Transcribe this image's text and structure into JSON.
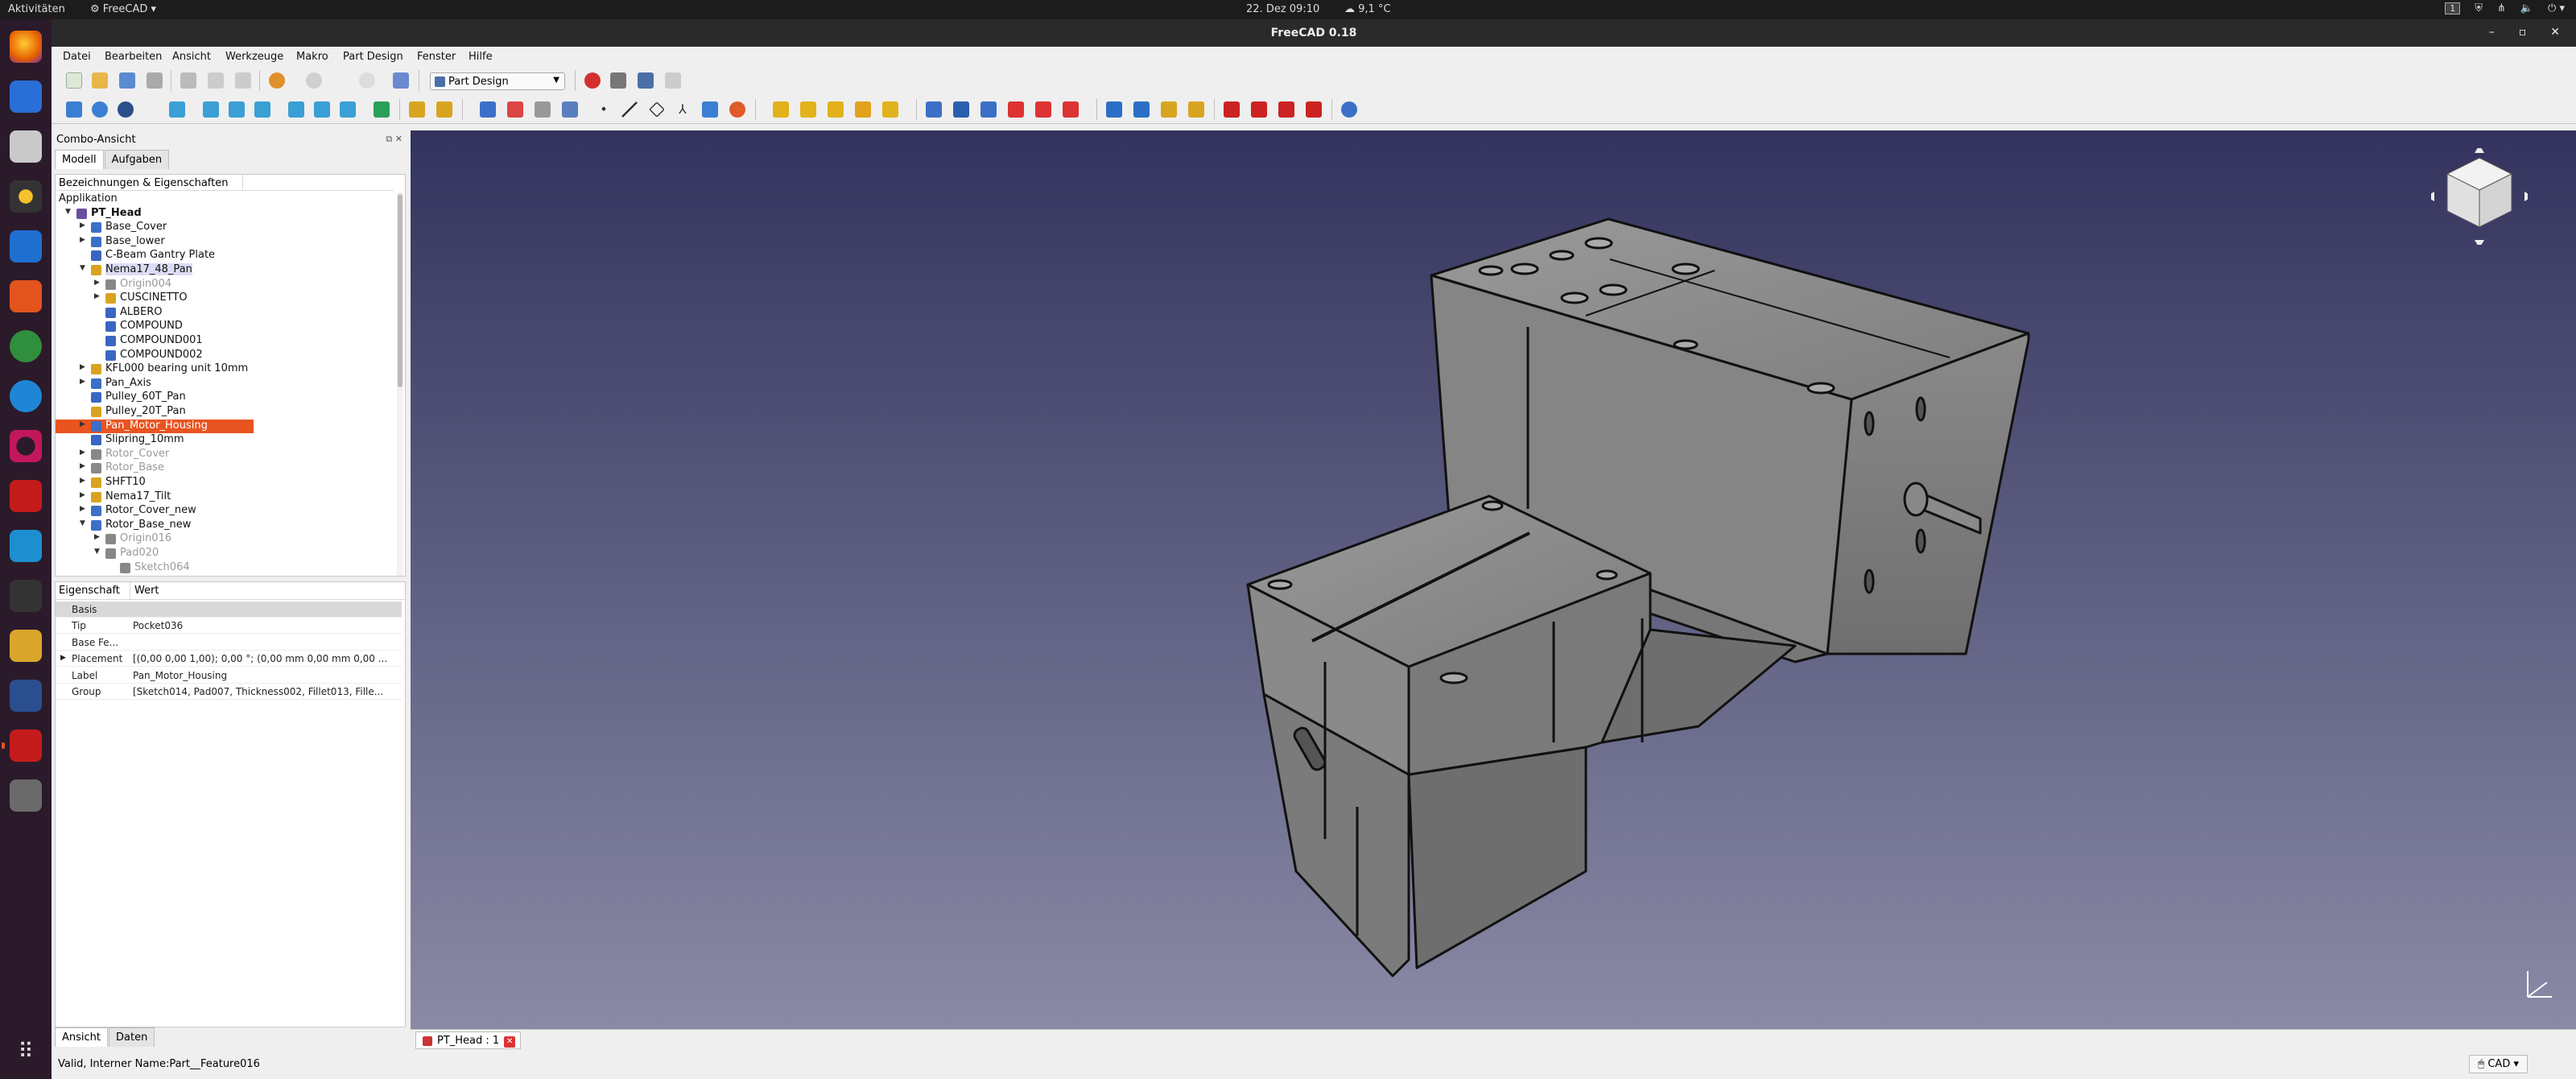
{
  "system": {
    "activities": "Aktivitäten",
    "app_name": "FreeCAD",
    "clock": "22. Dez 09:10",
    "weather": "9,1 °C",
    "workspace": "1"
  },
  "window": {
    "title": "FreeCAD 0.18"
  },
  "menu": {
    "items": [
      "Datei",
      "Bearbeiten",
      "Ansicht",
      "Werkzeuge",
      "Makro",
      "Part Design",
      "Fenster",
      "Hilfe"
    ]
  },
  "toolbar": {
    "workbench": "Part Design"
  },
  "combo": {
    "title": "Combo-Ansicht",
    "tabs": [
      "Modell",
      "Aufgaben"
    ],
    "tree_header": "Bezeichnungen & Eigenschaften",
    "tree": [
      {
        "label": "Applikation",
        "level": 0,
        "arrow": "",
        "icon": "",
        "state": ""
      },
      {
        "label": "PT_Head",
        "level": 1,
        "arrow": "▼",
        "icon": "#6a4fa0",
        "state": "bold"
      },
      {
        "label": "Base_Cover",
        "level": 2,
        "arrow": "▶",
        "icon": "#3c6fc7",
        "state": ""
      },
      {
        "label": "Base_lower",
        "level": 2,
        "arrow": "▶",
        "icon": "#3c6fc7",
        "state": ""
      },
      {
        "label": "C-Beam Gantry Plate",
        "level": 2,
        "arrow": "",
        "icon": "#3a66c2",
        "state": ""
      },
      {
        "label": "Nema17_48_Pan",
        "level": 2,
        "arrow": "▼",
        "icon": "#d8a420",
        "state": "hl"
      },
      {
        "label": "Origin004",
        "level": 3,
        "arrow": "▶",
        "icon": "#888",
        "state": "gray"
      },
      {
        "label": "CUSCINETTO",
        "level": 3,
        "arrow": "▶",
        "icon": "#d8a420",
        "state": ""
      },
      {
        "label": "ALBERO",
        "level": 3,
        "arrow": "",
        "icon": "#3a66c2",
        "state": ""
      },
      {
        "label": "COMPOUND",
        "level": 3,
        "arrow": "",
        "icon": "#3a66c2",
        "state": ""
      },
      {
        "label": "COMPOUND001",
        "level": 3,
        "arrow": "",
        "icon": "#3a66c2",
        "state": ""
      },
      {
        "label": "COMPOUND002",
        "level": 3,
        "arrow": "",
        "icon": "#3a66c2",
        "state": ""
      },
      {
        "label": "KFL000 bearing unit 10mm",
        "level": 2,
        "arrow": "▶",
        "icon": "#d8a420",
        "state": ""
      },
      {
        "label": "Pan_Axis",
        "level": 2,
        "arrow": "▶",
        "icon": "#3c6fc7",
        "state": ""
      },
      {
        "label": "Pulley_60T_Pan",
        "level": 2,
        "arrow": "",
        "icon": "#3a66c2",
        "state": ""
      },
      {
        "label": "Pulley_20T_Pan",
        "level": 2,
        "arrow": "",
        "icon": "#d8a420",
        "state": ""
      },
      {
        "label": "Pan_Motor_Housing",
        "level": 2,
        "arrow": "▶",
        "icon": "#3c6fc7",
        "state": "sel"
      },
      {
        "label": "Slipring_10mm",
        "level": 2,
        "arrow": "",
        "icon": "#3a66c2",
        "state": ""
      },
      {
        "label": "Rotor_Cover",
        "level": 2,
        "arrow": "▶",
        "icon": "#888",
        "state": "gray"
      },
      {
        "label": "Rotor_Base",
        "level": 2,
        "arrow": "▶",
        "icon": "#888",
        "state": "gray"
      },
      {
        "label": "SHFT10",
        "level": 2,
        "arrow": "▶",
        "icon": "#d8a420",
        "state": ""
      },
      {
        "label": "Nema17_Tilt",
        "level": 2,
        "arrow": "▶",
        "icon": "#d8a420",
        "state": ""
      },
      {
        "label": "Rotor_Cover_new",
        "level": 2,
        "arrow": "▶",
        "icon": "#3c6fc7",
        "state": ""
      },
      {
        "label": "Rotor_Base_new",
        "level": 2,
        "arrow": "▼",
        "icon": "#3c6fc7",
        "state": ""
      },
      {
        "label": "Origin016",
        "level": 3,
        "arrow": "▶",
        "icon": "#888",
        "state": "gray"
      },
      {
        "label": "Pad020",
        "level": 3,
        "arrow": "▼",
        "icon": "#888",
        "state": "gray"
      },
      {
        "label": "Sketch064",
        "level": 4,
        "arrow": "",
        "icon": "#888",
        "state": "gray"
      }
    ],
    "prop_headers": [
      "Eigenschaft",
      "Wert"
    ],
    "properties": [
      {
        "key": "Basis",
        "value": "",
        "group": true,
        "arrow": ""
      },
      {
        "key": "Tip",
        "value": "Pocket036",
        "group": false,
        "arrow": ""
      },
      {
        "key": "Base Fe...",
        "value": "",
        "group": false,
        "arrow": ""
      },
      {
        "key": "Placement",
        "value": "[(0,00 0,00 1,00); 0,00 °; (0,00 mm  0,00 mm  0,00 ...",
        "group": false,
        "arrow": "▶"
      },
      {
        "key": "Label",
        "value": "Pan_Motor_Housing",
        "group": false,
        "arrow": ""
      },
      {
        "key": "Group",
        "value": "[Sketch014, Pad007, Thickness002, Fillet013, Fille...",
        "group": false,
        "arrow": ""
      }
    ],
    "bottom_tabs": [
      "Ansicht",
      "Daten"
    ]
  },
  "view": {
    "tab_label": "PT_Head : 1",
    "close": "✕"
  },
  "status": {
    "message": "Valid, Interner Name:Part__Feature016",
    "nav_style": "CAD"
  }
}
